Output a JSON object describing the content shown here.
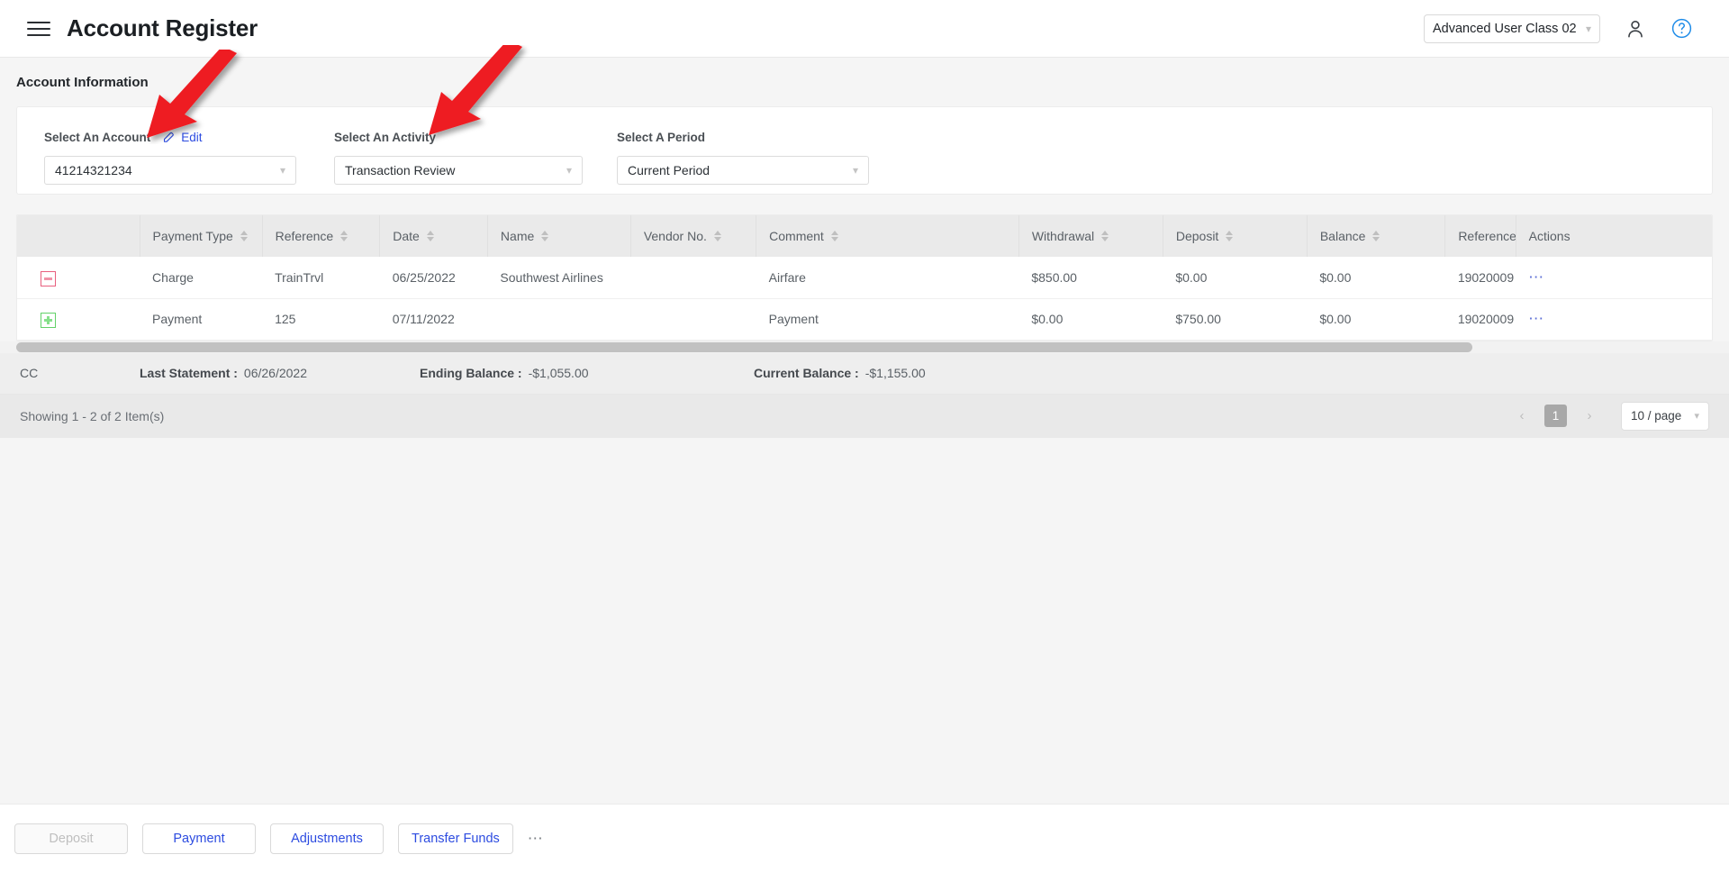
{
  "header": {
    "menu_icon": "hamburger-icon",
    "title": "Account Register",
    "user_class": "Advanced User Class 02",
    "avatar_icon": "user-icon",
    "help_icon": "question-circle-icon"
  },
  "section": {
    "title": "Account Information"
  },
  "filters": {
    "account": {
      "label": "Select An Account",
      "edit_label": "Edit",
      "edit_icon": "pencil-icon",
      "value": "41214321234"
    },
    "activity": {
      "label": "Select An Activity",
      "value": "Transaction Review"
    },
    "period": {
      "label": "Select A Period",
      "value": "Current Period"
    }
  },
  "table": {
    "columns": [
      {
        "key": "toggle",
        "label": "",
        "sortable": false
      },
      {
        "key": "ptype",
        "label": "Payment Type",
        "sortable": true
      },
      {
        "key": "ref",
        "label": "Reference",
        "sortable": true
      },
      {
        "key": "date",
        "label": "Date",
        "sortable": true
      },
      {
        "key": "name",
        "label": "Name",
        "sortable": true
      },
      {
        "key": "vendor",
        "label": "Vendor No.",
        "sortable": true
      },
      {
        "key": "comment",
        "label": "Comment",
        "sortable": true
      },
      {
        "key": "withdraw",
        "label": "Withdrawal",
        "sortable": true
      },
      {
        "key": "deposit",
        "label": "Deposit",
        "sortable": true
      },
      {
        "key": "balance",
        "label": "Balance",
        "sortable": true
      },
      {
        "key": "ref2",
        "label": "Reference",
        "sortable": false
      },
      {
        "key": "actions",
        "label": "Actions",
        "sortable": false
      }
    ],
    "rows": [
      {
        "toggle_icon": "collapse-minus-icon",
        "ptype": "Charge",
        "ref": "TrainTrvl",
        "date": "06/25/2022",
        "name": "Southwest Airlines",
        "vendor": "",
        "comment": "Airfare",
        "withdraw": "$850.00",
        "deposit": "$0.00",
        "balance": "$0.00",
        "ref2": "19020009",
        "actions_icon": "ellipsis-icon"
      },
      {
        "toggle_icon": "expand-plus-icon",
        "ptype": "Payment",
        "ref": "125",
        "date": "07/11/2022",
        "name": "",
        "vendor": "",
        "comment": "Payment",
        "withdraw": "$0.00",
        "deposit": "$750.00",
        "balance": "$0.00",
        "ref2": "19020009",
        "actions_icon": "ellipsis-icon"
      }
    ]
  },
  "summary": {
    "account_type": "CC",
    "last_statement_label": "Last Statement :",
    "last_statement_value": "06/26/2022",
    "ending_balance_label": "Ending Balance :",
    "ending_balance_value": "-$1,055.00",
    "current_balance_label": "Current Balance :",
    "current_balance_value": "-$1,155.00"
  },
  "pagination": {
    "showing": "Showing 1 - 2 of 2 Item(s)",
    "prev_icon": "chevron-left-icon",
    "next_icon": "chevron-right-icon",
    "current_page": "1",
    "page_size": "10 / page"
  },
  "footer": {
    "buttons": [
      {
        "label": "Deposit",
        "disabled": true
      },
      {
        "label": "Payment",
        "disabled": false
      },
      {
        "label": "Adjustments",
        "disabled": false
      },
      {
        "label": "Transfer Funds",
        "disabled": false
      }
    ],
    "more_icon": "ellipsis-icon"
  },
  "annotations": {
    "arrow_color": "#ee1c24",
    "arrows": [
      {
        "name": "arrow-to-select-an-account"
      },
      {
        "name": "arrow-to-select-an-activity"
      }
    ]
  }
}
